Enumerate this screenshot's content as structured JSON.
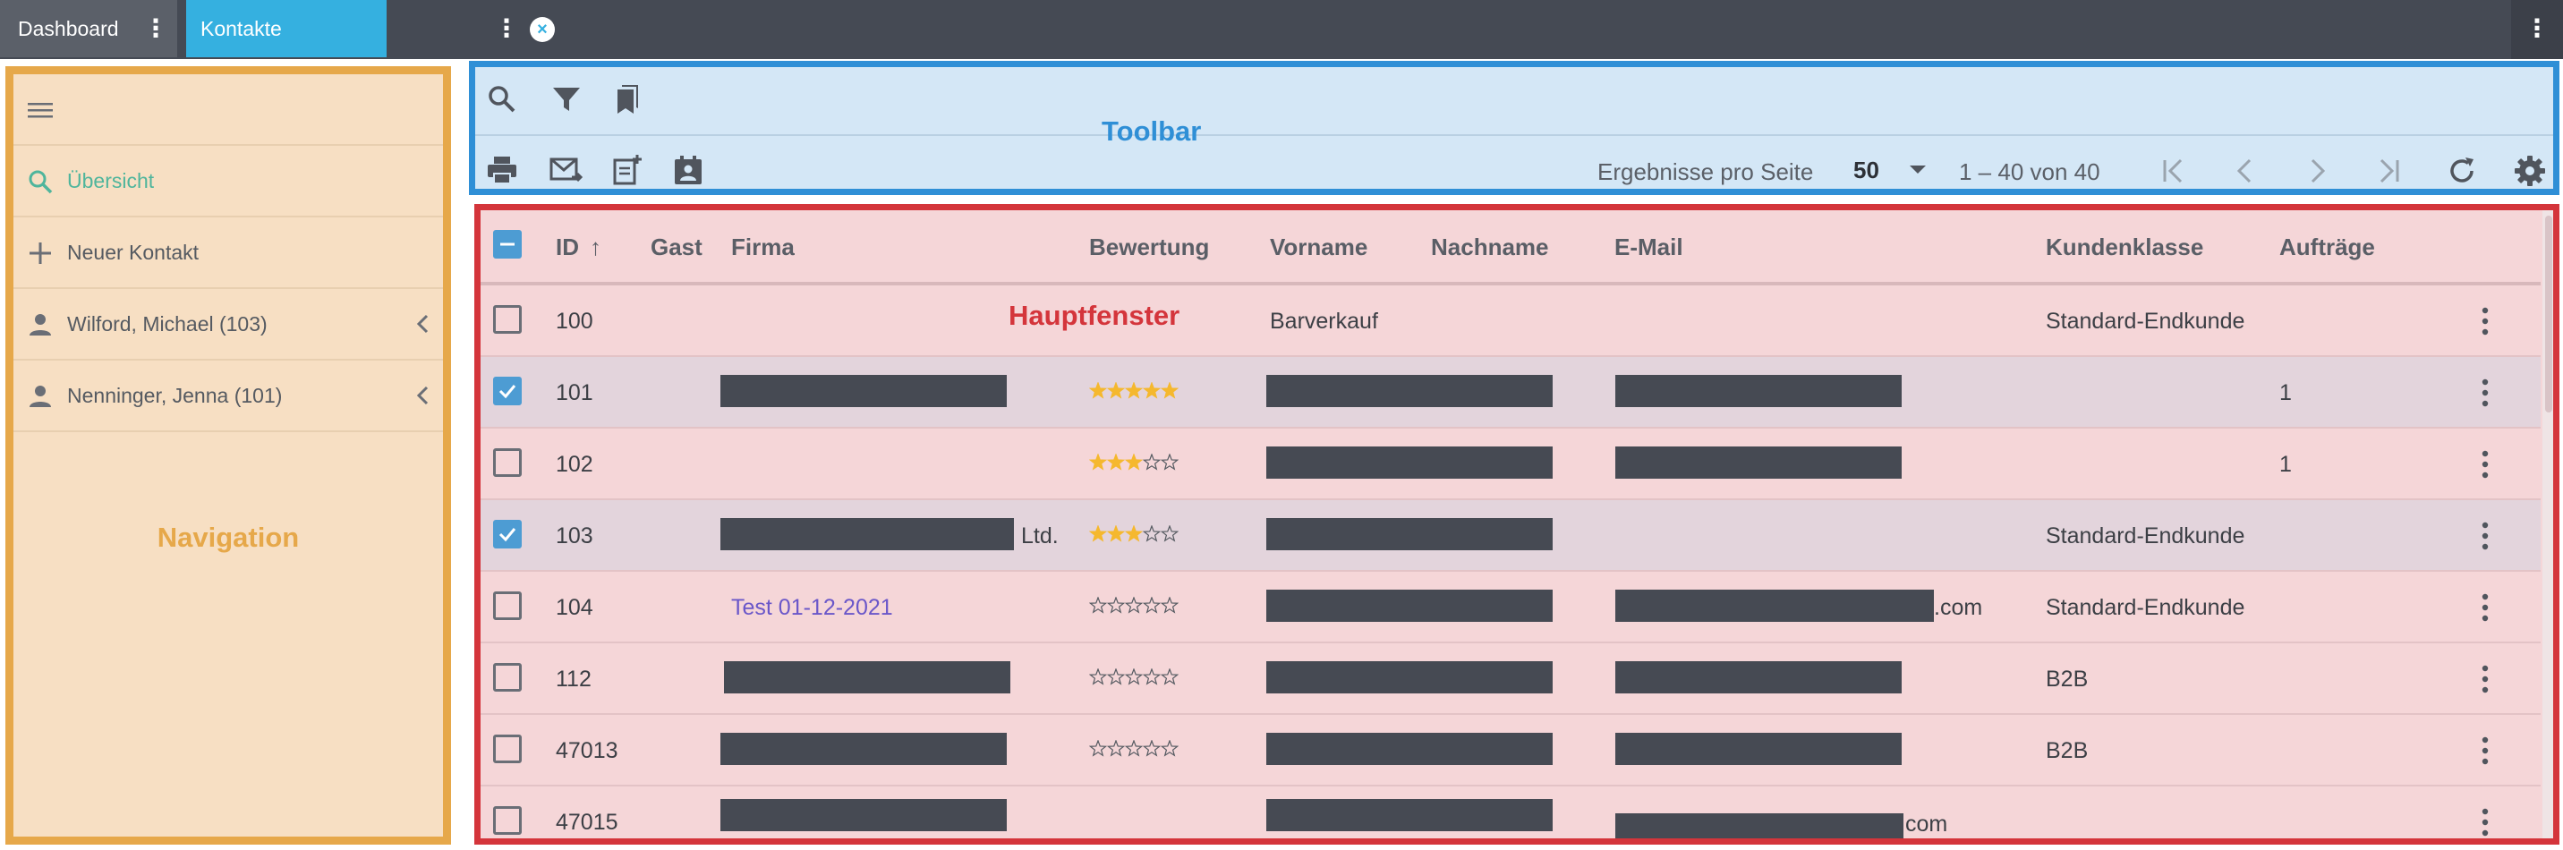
{
  "tabs": [
    {
      "label": "Dashboard"
    },
    {
      "label": "Kontakte"
    }
  ],
  "navigation": {
    "annotation": "Navigation",
    "items": [
      {
        "label": "Übersicht",
        "icon": "search-icon"
      },
      {
        "label": "Neuer Kontakt",
        "icon": "plus-icon"
      },
      {
        "label": "Wilford, Michael (103)",
        "icon": "person-icon"
      },
      {
        "label": "Nenninger, Jenna (101)",
        "icon": "person-icon"
      }
    ]
  },
  "toolbar": {
    "annotation": "Toolbar",
    "per_page_label": "Ergebnisse pro Seite",
    "per_page_value": "50",
    "range_text": "1 – 40 von 40"
  },
  "table": {
    "annotation": "Hauptfenster",
    "columns": [
      "ID",
      "Gast",
      "Firma",
      "Bewertung",
      "Vorname",
      "Nachname",
      "E-Mail",
      "Kundenklasse",
      "Aufträge"
    ],
    "sort_indicator": "↑",
    "rows": [
      {
        "id": "100",
        "firma": "",
        "vorname": "Barverkauf",
        "email_suffix": "",
        "klasse": "Standard-Endkunde",
        "auftraege": "",
        "rating": 0
      },
      {
        "id": "101",
        "firma": "",
        "vorname": "",
        "email_suffix": "",
        "klasse": "",
        "auftraege": "1",
        "rating": 5
      },
      {
        "id": "102",
        "firma": "",
        "vorname": "",
        "email_suffix": "",
        "klasse": "",
        "auftraege": "1",
        "rating": 3
      },
      {
        "id": "103",
        "firma": "Ltd.",
        "vorname": "",
        "email_suffix": "",
        "klasse": "Standard-Endkunde",
        "auftraege": "",
        "rating": 3
      },
      {
        "id": "104",
        "firma": "Test 01-12-2021",
        "vorname": "",
        "email_suffix": ".com",
        "klasse": "Standard-Endkunde",
        "auftraege": "",
        "rating": 0
      },
      {
        "id": "112",
        "firma": "",
        "vorname": "",
        "email_suffix": "",
        "klasse": "B2B",
        "auftraege": "",
        "rating": 0
      },
      {
        "id": "47013",
        "firma": "",
        "vorname": "",
        "email_suffix": "",
        "klasse": "B2B",
        "auftraege": "",
        "rating": 0
      },
      {
        "id": "47015",
        "firma": "",
        "vorname": "",
        "email_suffix": "com",
        "klasse": "",
        "auftraege": "",
        "rating": null
      }
    ]
  },
  "colors": {
    "tabbar": "#454a54",
    "tab_active": "#35b0e0",
    "navigation_accent": "#e6a84a",
    "toolbar_accent": "#2f8fd6",
    "main_accent": "#d4353b",
    "star_filled": "#f5b82e",
    "checkbox_checked": "#4d9cd3"
  }
}
